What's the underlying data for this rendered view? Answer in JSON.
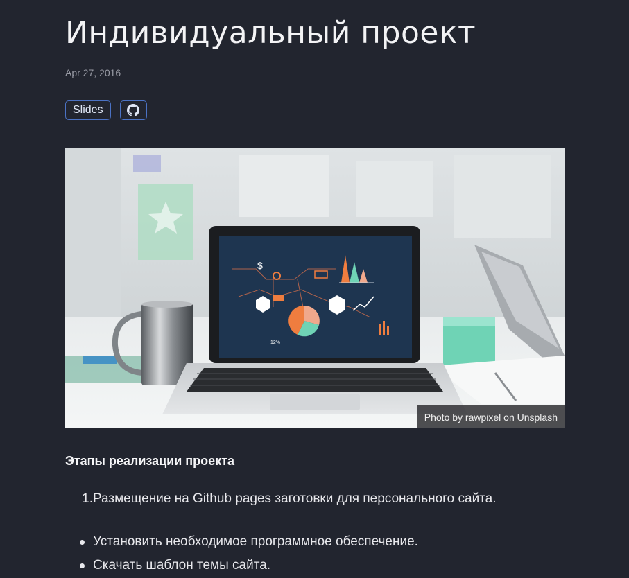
{
  "post": {
    "title": "Индивидуальный проект",
    "date": "Apr 27, 2016"
  },
  "links": {
    "slides_label": "Slides",
    "github_icon": "github-icon"
  },
  "image": {
    "caption": "Photo by rawpixel on Unsplash",
    "chart_label": "12%"
  },
  "content": {
    "section_heading": "Этапы реализации проекта",
    "ordered": [
      {
        "num": "1.",
        "text": "Размещение на Github pages заготовки для персонального сайта."
      }
    ],
    "bullets": [
      "Установить необходимое программное обеспечение.",
      "Скачать шаблон темы сайта."
    ]
  },
  "colors": {
    "background": "#22252f",
    "button_border": "#4b72c4",
    "text": "#e6e6ea"
  }
}
